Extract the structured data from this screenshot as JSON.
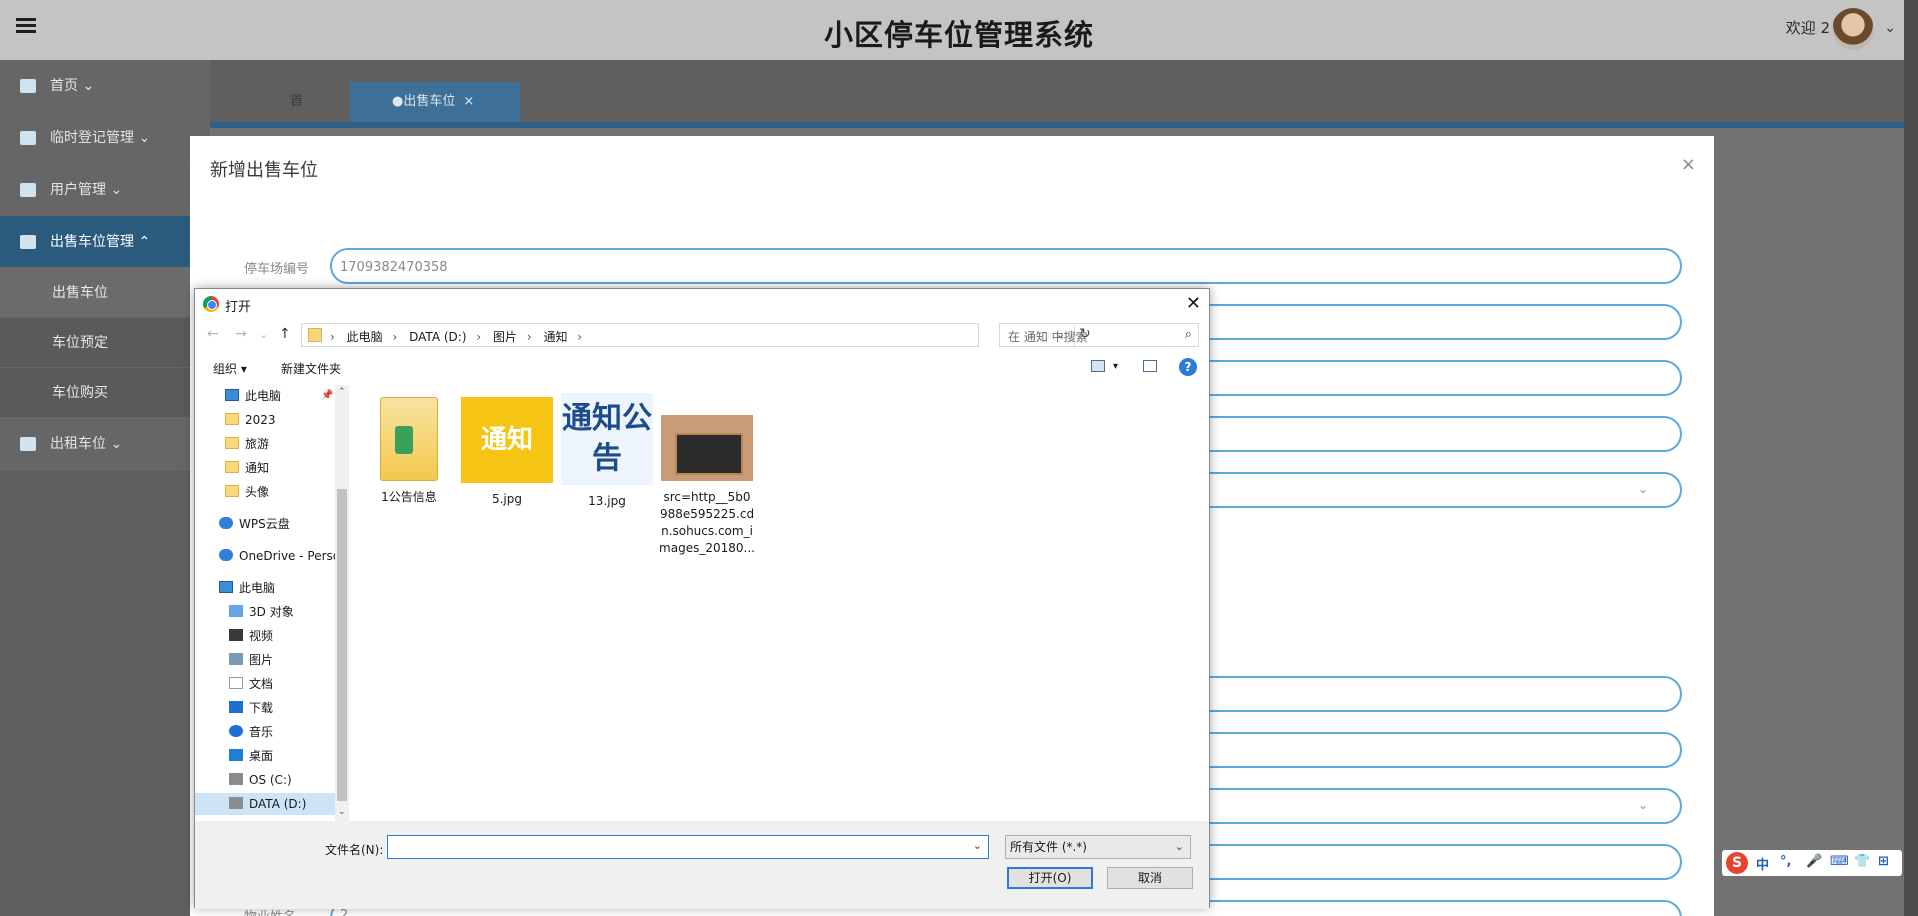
{
  "app": {
    "title": "小区停车位管理系统",
    "welcome": "欢迎 2",
    "user_caret": "⌄",
    "menu_icon": "hamburger-icon"
  },
  "sidebar": {
    "items": [
      {
        "label": "首页 ⌄",
        "icon": "home-icon"
      },
      {
        "label": "临时登记管理 ⌄",
        "icon": "card-icon"
      },
      {
        "label": "用户管理 ⌄",
        "icon": "user-icon"
      },
      {
        "label": "出售车位管理 ⌃",
        "icon": "building-icon"
      }
    ],
    "sub_items": [
      "出售车位",
      "车位预定",
      "车位购买"
    ],
    "last_item": {
      "label": "出租车位 ⌄",
      "icon": "chart-icon"
    }
  },
  "tabs": {
    "home": "首页",
    "active": "●出售车位",
    "close": "×"
  },
  "modal": {
    "title": "新增出售车位",
    "close": "×",
    "fields": [
      {
        "label": "停车场编号",
        "value": "1709382470358"
      },
      {
        "label": "物业姓名",
        "value": "2"
      }
    ],
    "select_caret": "⌄"
  },
  "dialog": {
    "title": "打开",
    "close": "✕",
    "nav": {
      "back": "←",
      "forward": "→",
      "dropdown": "⌄",
      "up": "↑"
    },
    "breadcrumb": [
      "此电脑",
      "DATA (D:)",
      "图片",
      "通知"
    ],
    "breadcrumb_sep": "›",
    "address_dropdown": "⌄",
    "refresh": "↻",
    "search_placeholder": "在 通知 中搜索",
    "search_icon": "⌕",
    "toolbar": {
      "organize": "组织 ▾",
      "new_folder": "新建文件夹",
      "view_caret": "▾",
      "help": "?"
    },
    "nav_items": [
      {
        "label": "此电脑",
        "icon": "pc-icon"
      },
      {
        "label": "2023",
        "icon": "folder-icon"
      },
      {
        "label": "旅游",
        "icon": "folder-icon"
      },
      {
        "label": "通知",
        "icon": "folder-icon"
      },
      {
        "label": "头像",
        "icon": "folder-icon"
      },
      {
        "label": "WPS云盘",
        "icon": "cloud-icon"
      },
      {
        "label": "OneDrive - Perso",
        "icon": "onedrive-icon"
      },
      {
        "label": "此电脑",
        "icon": "pc-icon"
      },
      {
        "label": "3D 对象",
        "icon": "cube-icon"
      },
      {
        "label": "视频",
        "icon": "video-icon"
      },
      {
        "label": "图片",
        "icon": "picture-icon"
      },
      {
        "label": "文档",
        "icon": "document-icon"
      },
      {
        "label": "下载",
        "icon": "download-icon"
      },
      {
        "label": "音乐",
        "icon": "music-icon"
      },
      {
        "label": "桌面",
        "icon": "desktop-icon"
      },
      {
        "label": "OS (C:)",
        "icon": "drive-icon"
      },
      {
        "label": "DATA (D:)",
        "icon": "drive-icon"
      }
    ],
    "pin": "📌",
    "scroll_up": "⌃",
    "scroll_down": "⌄",
    "files": [
      {
        "name": "1公告信息",
        "type": "folder"
      },
      {
        "name": "5.jpg",
        "type": "image",
        "thumb_text": "通知"
      },
      {
        "name": "13.jpg",
        "type": "image",
        "thumb_text": "通知公告"
      },
      {
        "name": "src=http__5b0988e595225.cdn.sohucs.com_images_20180...",
        "type": "image",
        "lines": [
          "src=http__5b0",
          "988e595225.cd",
          "n.sohucs.com_i",
          "mages_20180..."
        ]
      }
    ],
    "filename_label": "文件名(N):",
    "filename_value": "",
    "filename_caret": "⌄",
    "filter": "所有文件 (*.*)",
    "filter_caret": "⌄",
    "open_button": "打开(O)",
    "cancel_button": "取消"
  },
  "ime": {
    "logo": "S",
    "items": [
      "中",
      "°,",
      "🎤",
      "⌨",
      "👕",
      "⊞"
    ]
  }
}
